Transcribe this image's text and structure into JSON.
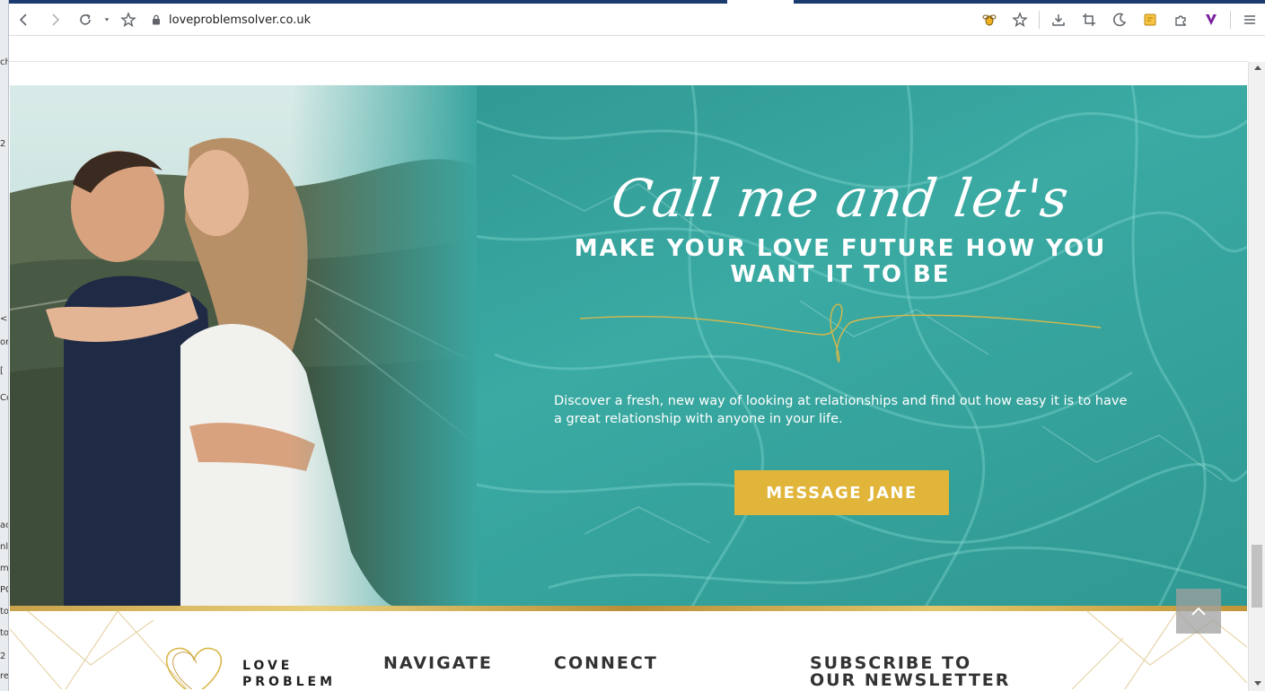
{
  "browser": {
    "url": "loveproblemsolver.co.uk",
    "toolbar_icons": [
      "back-icon",
      "forward-icon",
      "reload-icon",
      "star-icon",
      "lock-icon",
      "extension-bee-icon",
      "bookmark-star-icon",
      "download-icon",
      "crop-icon",
      "night-mode-icon",
      "notes-icon",
      "puzzle-icon",
      "vpn-icon",
      "menu-icon"
    ]
  },
  "hero": {
    "script_line": "Call me and let's",
    "headline": "MAKE YOUR LOVE FUTURE HOW YOU WANT IT TO BE",
    "description": "Discover a fresh, new way of looking at relationships and find out how easy it is to have a great relationship with anyone in your life.",
    "cta_label": "MESSAGE JANE"
  },
  "footer": {
    "logo_line1": "LOVE",
    "logo_line2": "PROBLEM",
    "navigate_heading": "NAVIGATE",
    "connect_heading": "CONNECT",
    "subscribe_line1": "SUBSCRIBE TO",
    "subscribe_line2": "OUR NEWSLETTER"
  },
  "colors": {
    "teal": "#3aa59f",
    "gold": "#e0b53a",
    "tab_accent": "#1b3a70"
  }
}
